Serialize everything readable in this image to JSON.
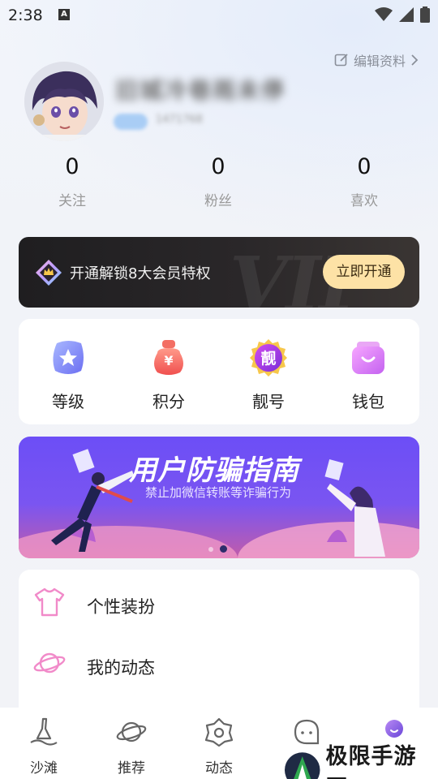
{
  "status_bar": {
    "time": "2:38",
    "notification_glyph": "A"
  },
  "profile": {
    "edit_label": "编辑资料",
    "nickname": "旧城冷巷雨未停",
    "uid": "1471768"
  },
  "stats": [
    {
      "value": "0",
      "label": "关注"
    },
    {
      "value": "0",
      "label": "粉丝"
    },
    {
      "value": "0",
      "label": "喜欢"
    }
  ],
  "vip": {
    "text": "开通解锁8大会员特权",
    "button": "立即开通",
    "watermark": "VIP"
  },
  "features": [
    {
      "label": "等级",
      "icon": "star-badge-icon"
    },
    {
      "label": "积分",
      "icon": "yuan-bag-icon"
    },
    {
      "label": "靓号",
      "icon": "pretty-number-icon",
      "glyph": "靓"
    },
    {
      "label": "钱包",
      "icon": "wallet-icon"
    }
  ],
  "banner": {
    "title": "用户防骗指南",
    "subtitle": "禁止加微信转账等诈骗行为",
    "slide_count": 2,
    "active_slide": 2
  },
  "menu": [
    {
      "label": "个性装扮",
      "icon": "tshirt-icon"
    },
    {
      "label": "我的动态",
      "icon": "planet-icon"
    }
  ],
  "bottom_nav": [
    {
      "label": "沙滩",
      "icon": "beach-icon"
    },
    {
      "label": "推荐",
      "icon": "planet-icon"
    },
    {
      "label": "动态",
      "icon": "flower-icon"
    },
    {
      "label": "",
      "icon": "chat-icon"
    },
    {
      "label": "",
      "icon": "profile-face-icon"
    }
  ],
  "site_watermark": {
    "text": "极限手游网"
  },
  "colors": {
    "accent": "#f18ac9",
    "vip_button": "#fde2a6",
    "banner": "#6c4ef6"
  }
}
